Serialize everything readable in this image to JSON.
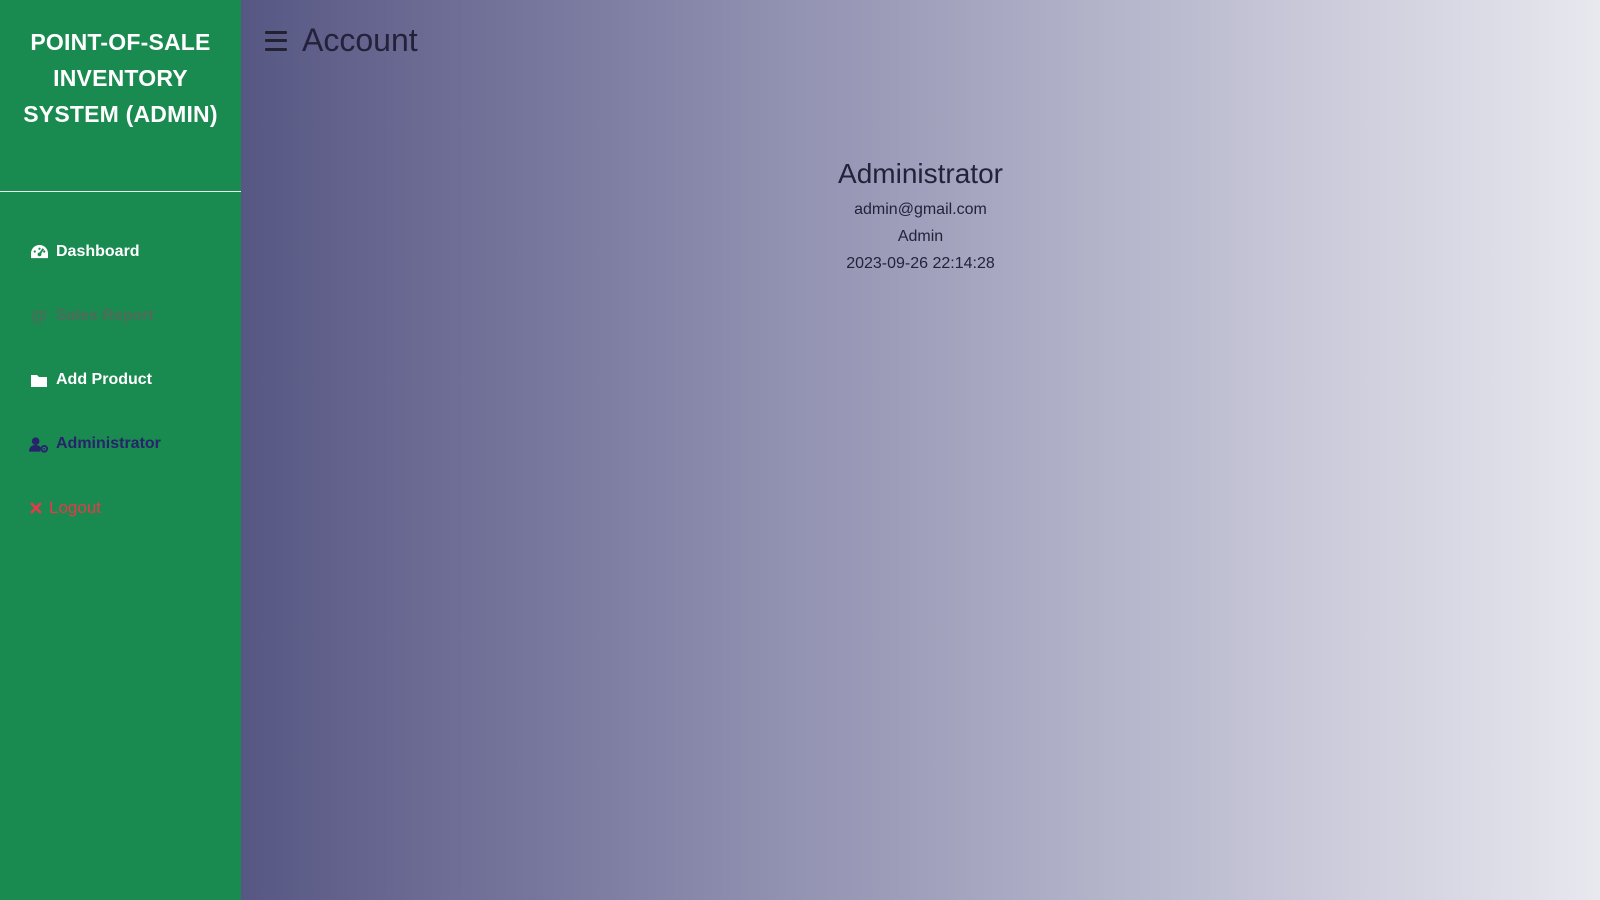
{
  "sidebar": {
    "brand_title": "POINT-OF-SALE INVENTORY SYSTEM (ADMIN)",
    "items": [
      {
        "label": "Dashboard",
        "icon": "dashboard-gauge-icon",
        "color": "#ffffff"
      },
      {
        "label": "Sales Report",
        "icon": "at-sign-icon",
        "color": "#4f6b59"
      },
      {
        "label": "Add Product",
        "icon": "folder-icon",
        "color": "#ffffff"
      },
      {
        "label": "Administrator",
        "icon": "user-gear-icon",
        "color": "#27246b"
      },
      {
        "label": "Logout",
        "icon": "close-x-icon",
        "color": "#e8394a"
      }
    ]
  },
  "header": {
    "menu_icon": "hamburger-menu-icon",
    "title": "Account"
  },
  "account": {
    "name": "Administrator",
    "email": "admin@gmail.com",
    "role": "Admin",
    "timestamp": "2023-09-26 22:14:28"
  },
  "colors": {
    "sidebar_bg": "#198a50",
    "text_dark": "#22223a"
  }
}
